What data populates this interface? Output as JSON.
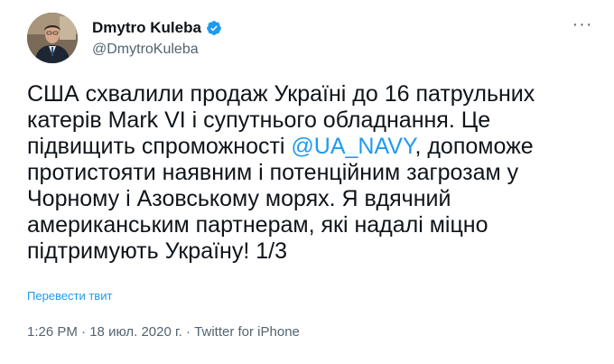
{
  "author": {
    "display_name": "Dmytro Kuleba",
    "handle": "@DmytroKuleba",
    "verified": true,
    "avatar_icon": "avatar-photo"
  },
  "menu": {
    "more_icon": "more-horizontal-icon",
    "more_glyph": "···"
  },
  "tweet": {
    "text_before_mention": "США схвалили продаж Україні до 16 патрульних\nкатерів Mark VI і супутнього обладнання. Це\nпідвищить спроможності ",
    "mention": "@UA_NAVY",
    "text_after_mention": ", допоможе\nпротистояти наявним і потенційним загрозам у\nЧорному і Азовському морях. Я вдячний\nамериканським партнерам, які надалі міцно\nпідтримують Україну! 1/3",
    "translate_label": "Перевести твит"
  },
  "meta": {
    "time": "1:26 PM",
    "separator": " · ",
    "date": "18 июл. 2020 г.",
    "source": "Twitter for iPhone"
  },
  "colors": {
    "link": "#1d9bf0",
    "text": "#0f1419",
    "secondary": "#536471"
  }
}
